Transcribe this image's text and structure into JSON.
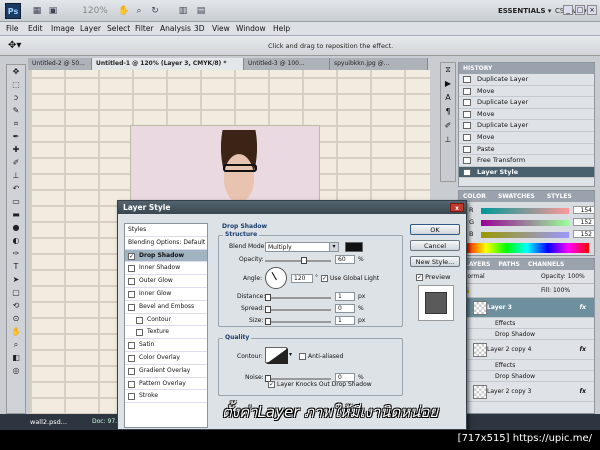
{
  "app": {
    "logo": "Ps",
    "workspace": "ESSENTIALS ▾",
    "cs_live": "CS Live ▾",
    "zoom": "120%"
  },
  "menu": [
    "File",
    "Edit",
    "Image",
    "Layer",
    "Select",
    "Filter",
    "Analysis",
    "3D",
    "View",
    "Window",
    "Help"
  ],
  "options_bar": {
    "hint": "Click and drag to reposition the effect."
  },
  "doc_tabs": [
    {
      "label": "Untitled-2 @ 50..."
    },
    {
      "label": "Untitled-1 @ 120% (Layer 3, CMYK/8) *"
    },
    {
      "label": "Untitled-3 @ 100..."
    },
    {
      "label": "spyuibkkn.jpg @..."
    }
  ],
  "history": {
    "title": "HISTORY",
    "items": [
      "Duplicate Layer",
      "Move",
      "Duplicate Layer",
      "Move",
      "Duplicate Layer",
      "Move",
      "Paste",
      "Free Transform",
      "Layer Style"
    ]
  },
  "color_panel": {
    "tabs": [
      "COLOR",
      "SWATCHES",
      "STYLES"
    ],
    "channels": [
      {
        "label": "R",
        "value": "154"
      },
      {
        "label": "G",
        "value": "152"
      },
      {
        "label": "B",
        "value": "152"
      }
    ]
  },
  "layers_panel": {
    "tabs": [
      "LAYERS",
      "PATHS",
      "CHANNELS"
    ],
    "blend": "Normal",
    "opacity": "Opacity: 100%",
    "fill": "Fill: 100%",
    "rows": [
      {
        "label": "Layer 3",
        "fx": "fx",
        "type": "layer",
        "selected": true
      },
      {
        "label": "Effects",
        "type": "sub"
      },
      {
        "label": "Drop Shadow",
        "type": "sub"
      },
      {
        "label": "Layer 2 copy 4",
        "fx": "fx",
        "type": "layer"
      },
      {
        "label": "Effects",
        "type": "sub"
      },
      {
        "label": "Drop Shadow",
        "type": "sub"
      },
      {
        "label": "Layer 2 copy 3",
        "fx": "fx",
        "type": "layer"
      }
    ]
  },
  "status": {
    "filename": "wall2.psd...",
    "doc": "Doc: 97..."
  },
  "dialog": {
    "title": "Layer Style",
    "close": "x",
    "styles": [
      {
        "label": "Styles",
        "kind": "head"
      },
      {
        "label": "Blending Options: Default",
        "kind": "head"
      },
      {
        "label": "Drop Shadow",
        "checked": true,
        "selected": true
      },
      {
        "label": "Inner Shadow"
      },
      {
        "label": "Outer Glow"
      },
      {
        "label": "Inner Glow"
      },
      {
        "label": "Bevel and Emboss"
      },
      {
        "label": "Contour",
        "indent": true
      },
      {
        "label": "Texture",
        "indent": true
      },
      {
        "label": "Satin"
      },
      {
        "label": "Color Overlay"
      },
      {
        "label": "Gradient Overlay"
      },
      {
        "label": "Pattern Overlay"
      },
      {
        "label": "Stroke"
      }
    ],
    "section_title": "Drop Shadow",
    "structure": {
      "title": "Structure",
      "blend_mode_label": "Blend Mode:",
      "blend_mode": "Multiply",
      "opacity_label": "Opacity:",
      "opacity": "60",
      "opacity_fraction": 0.6,
      "angle_label": "Angle:",
      "angle": "120",
      "use_global_light": "Use Global Light",
      "distance_label": "Distance:",
      "distance": "1",
      "spread_label": "Spread:",
      "spread": "0",
      "size_label": "Size:",
      "size": "1",
      "pct": "%",
      "px": "px",
      "deg": "°"
    },
    "quality": {
      "title": "Quality",
      "contour_label": "Contour:",
      "anti_aliased": "Anti-aliased",
      "noise_label": "Noise:",
      "noise": "0",
      "knockout": "Layer Knocks Out Drop Shadow"
    },
    "buttons": {
      "ok": "OK",
      "cancel": "Cancel",
      "new_style": "New Style...",
      "preview": "Preview"
    }
  },
  "watermark": "ตั้งค่าLayer ภาพให้มีเงานิดหน่อย",
  "credit": "[717x515] https://upic.me/"
}
